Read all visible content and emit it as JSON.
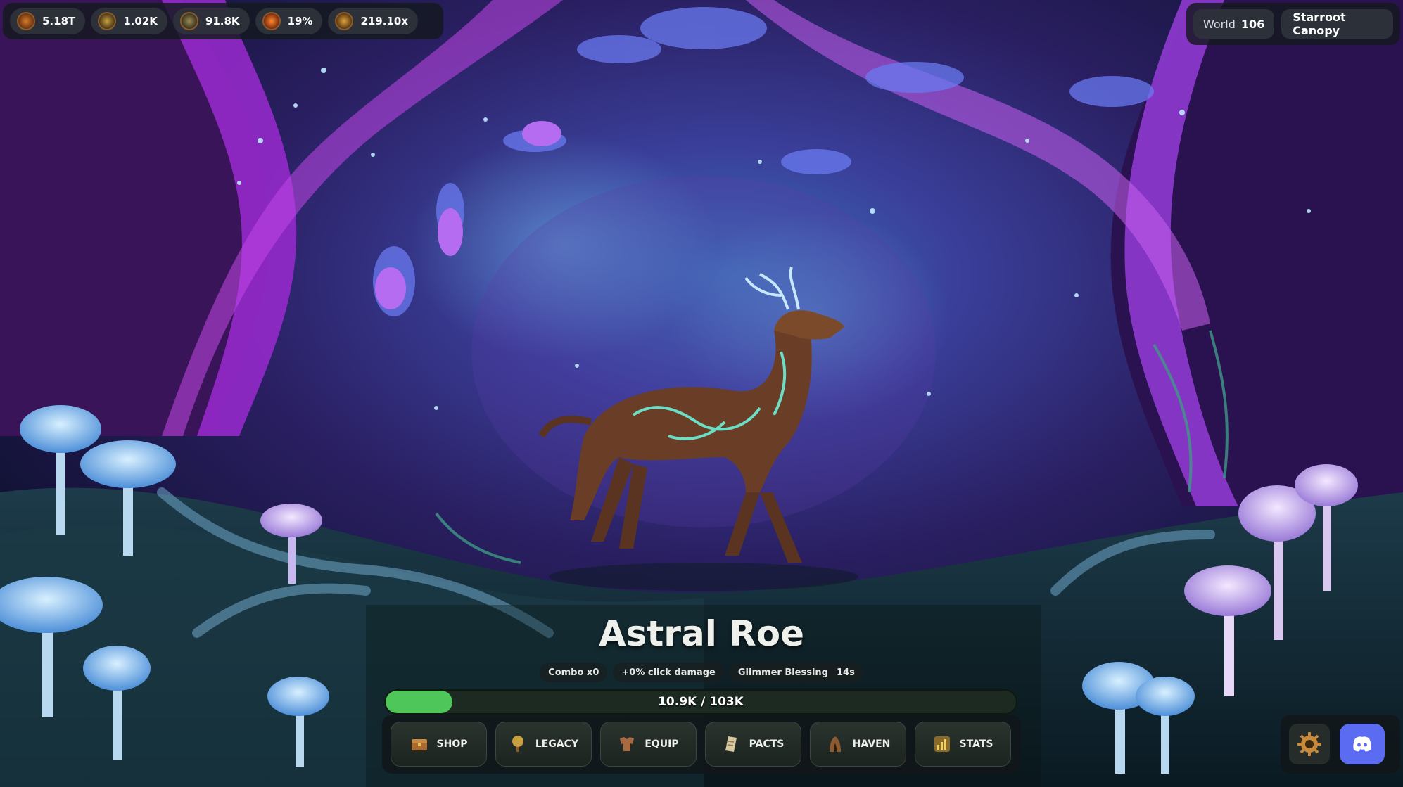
{
  "resources": [
    {
      "icon": "coin-icon",
      "value": "5.18T"
    },
    {
      "icon": "spark-icon",
      "value": "1.02K"
    },
    {
      "icon": "gem-icon",
      "value": "91.8K"
    },
    {
      "icon": "crit-icon",
      "value": "19%"
    },
    {
      "icon": "multiplier-icon",
      "value": "219.10x"
    }
  ],
  "world": {
    "label": "World",
    "number": "106",
    "zone": "Starroot Canopy"
  },
  "enemy": {
    "name": "Astral Roe"
  },
  "buffs": {
    "combo": "Combo x0",
    "click_damage": "+0% click damage",
    "blessing_name": "Glimmer Blessing",
    "blessing_time": "14s"
  },
  "health": {
    "text": "10.9K / 103K",
    "current": 10900,
    "max": 103000
  },
  "nav": [
    {
      "label": "SHOP",
      "icon": "chest-icon"
    },
    {
      "label": "LEGACY",
      "icon": "tree-icon"
    },
    {
      "label": "EQUIP",
      "icon": "armor-icon"
    },
    {
      "label": "PACTS",
      "icon": "scroll-icon"
    },
    {
      "label": "HAVEN",
      "icon": "tent-icon"
    },
    {
      "label": "STATS",
      "icon": "chart-icon"
    }
  ],
  "colors": {
    "hp_fill": "#4fc65a",
    "discord": "#5b6cf2"
  }
}
